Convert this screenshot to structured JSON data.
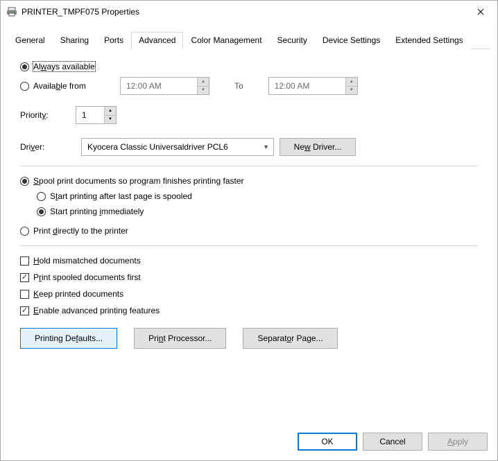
{
  "title": "PRINTER_TMPF075 Properties",
  "tabs": [
    "General",
    "Sharing",
    "Ports",
    "Advanced",
    "Color Management",
    "Security",
    "Device Settings",
    "Extended Settings"
  ],
  "activeTab": "Advanced",
  "availability": {
    "always": "Always available",
    "ranged": "Available from",
    "from": "12:00 AM",
    "toLabel": "To",
    "to": "12:00 AM"
  },
  "priority": {
    "label": "Priority:",
    "value": "1"
  },
  "driver": {
    "label": "Driver:",
    "value": "Kyocera Classic Universaldriver PCL6",
    "newBtn": "New Driver..."
  },
  "spool": {
    "spoolLabel": "Spool print documents so program finishes printing faster",
    "afterLast": "Start printing after last page is spooled",
    "immediately": "Start printing immediately",
    "direct": "Print directly to the printer"
  },
  "checks": {
    "hold": "Hold mismatched documents",
    "spooledFirst": "Print spooled documents first",
    "keep": "Keep printed documents",
    "enableAdv": "Enable advanced printing features"
  },
  "btns": {
    "defaults": "Printing Defaults...",
    "processor": "Print Processor...",
    "separator": "Separator Page..."
  },
  "dialog": {
    "ok": "OK",
    "cancel": "Cancel",
    "apply": "Apply"
  }
}
